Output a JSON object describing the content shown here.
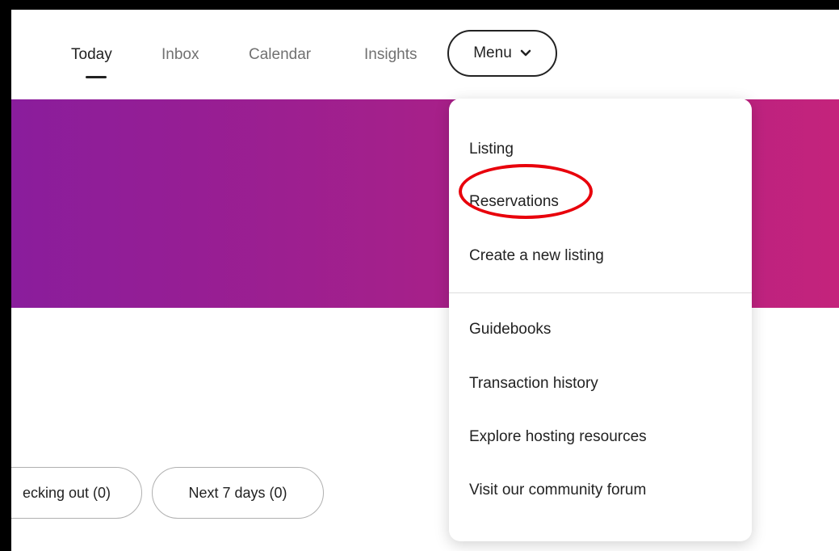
{
  "nav": {
    "tabs": [
      {
        "label": "Today"
      },
      {
        "label": "Inbox"
      },
      {
        "label": "Calendar"
      },
      {
        "label": "Insights"
      }
    ],
    "menu_label": "Menu",
    "active_tab": "Today"
  },
  "banner": {
    "gradient_colors": [
      "#8a1d9c",
      "#a6208a",
      "#c4237c"
    ]
  },
  "filters": {
    "chips": [
      {
        "label": "ecking out (0)"
      },
      {
        "label": "Next 7 days (0)"
      }
    ]
  },
  "dropdown": {
    "items": [
      {
        "label": "Listing"
      },
      {
        "label": "Reservations"
      },
      {
        "label": "Create a new listing"
      },
      {
        "label": "Guidebooks"
      },
      {
        "label": "Transaction history"
      },
      {
        "label": "Explore hosting resources"
      },
      {
        "label": "Visit our community forum"
      }
    ]
  },
  "annotation": {
    "highlight_color": "#e8000b",
    "highlighted_item": "Reservations"
  },
  "icons": {
    "menu_chevron": "chevron-down-icon"
  }
}
